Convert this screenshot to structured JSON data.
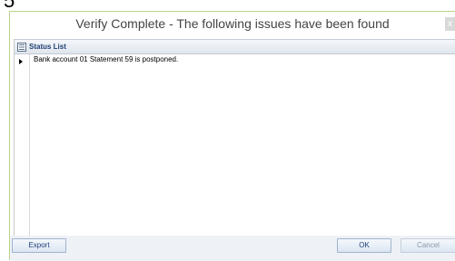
{
  "stray_char": "5",
  "dialog": {
    "title": "Verify Complete - The following issues have been found",
    "close_label": "x"
  },
  "status_list": {
    "header": "Status List",
    "rows": [
      {
        "message": "Bank account 01 Statement 59 is postponed."
      }
    ]
  },
  "footer": {
    "export_label": "Export",
    "ok_label": "OK",
    "cancel_label": "Cancel"
  },
  "colors": {
    "dialog_border": "#b9d38a",
    "header_text": "#1f3f76",
    "footer_bg": "#eef2f7"
  }
}
